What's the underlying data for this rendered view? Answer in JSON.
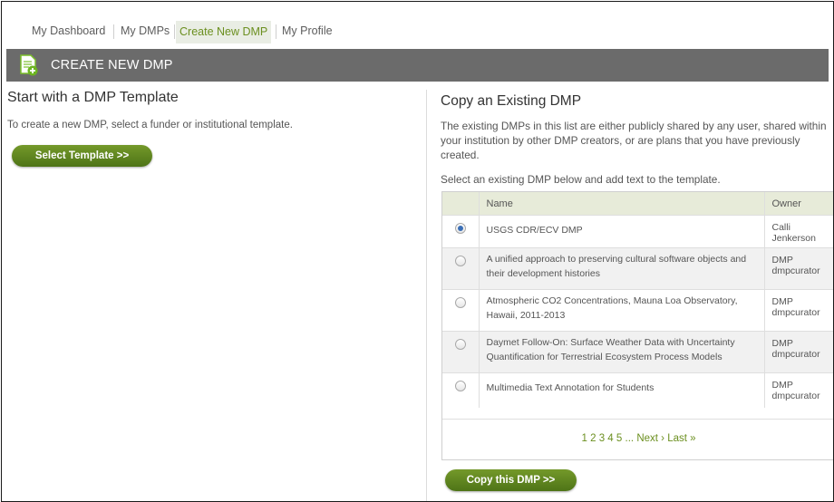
{
  "nav": {
    "items": [
      {
        "label": "My Dashboard"
      },
      {
        "label": "My DMPs"
      },
      {
        "label": "Create New DMP"
      },
      {
        "label": "My Profile"
      }
    ],
    "active": "Create New DMP"
  },
  "header": {
    "title": "CREATE NEW DMP",
    "icon": "document-add-icon"
  },
  "left": {
    "title": "Start with a DMP Template",
    "description": "To create a new DMP, select a funder or institutional template.",
    "button_label": "Select Template >>"
  },
  "right": {
    "title": "Copy an Existing DMP",
    "description": "The existing DMPs in this list are either publicly shared by any user, shared within your institution by other DMP creators, or are plans that you have previously created.",
    "instruction": "Select an existing DMP below and add text to the template.",
    "table": {
      "columns": [
        "Name",
        "Owner"
      ],
      "rows": [
        {
          "name": "USGS CDR/ECV DMP",
          "owner": "Calli Jenkerson",
          "selected": true
        },
        {
          "name": "A unified approach to preserving cultural software objects and their development histories",
          "owner": "DMP dmpcurator",
          "selected": false
        },
        {
          "name": "Atmospheric CO2 Concentrations, Mauna Loa Observatory, Hawaii, 2011-2013",
          "owner": "DMP dmpcurator",
          "selected": false
        },
        {
          "name": "Daymet Follow-On: Surface Weather Data with Uncertainty Quantification for Terrestrial Ecosystem Process Models",
          "owner": "DMP dmpcurator",
          "selected": false
        },
        {
          "name": "Multimedia Text Annotation for Students",
          "owner": "DMP dmpcurator",
          "selected": false
        }
      ]
    },
    "pagination": {
      "pages": [
        "1",
        "2",
        "3",
        "4",
        "5"
      ],
      "ellipsis": "...",
      "next": "Next ›",
      "last": "Last »"
    },
    "button_label": "Copy this DMP >>"
  },
  "colors": {
    "accent_green": "#6b8f1f",
    "header_gray": "#6b6b6b",
    "table_header": "#e7ebd9"
  }
}
